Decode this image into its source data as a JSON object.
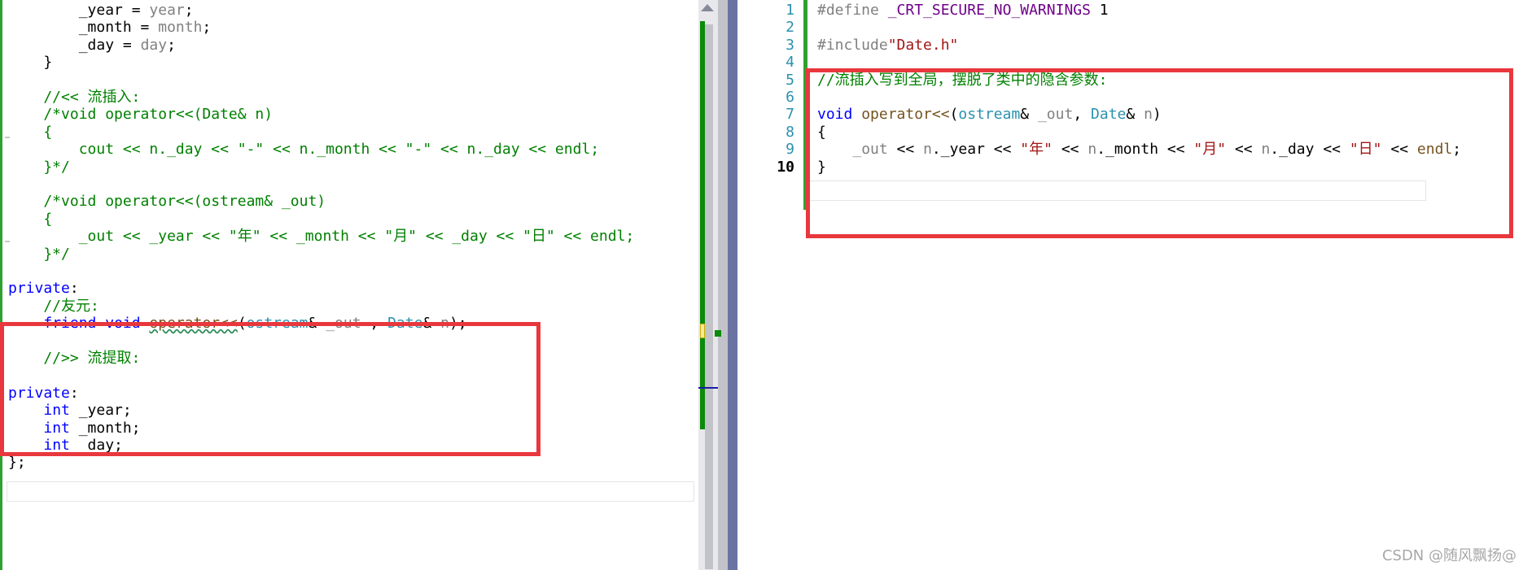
{
  "left_editor": {
    "lines": [
      {
        "segments": [
          {
            "t": "        _year = ",
            "c": ""
          },
          {
            "t": "year",
            "c": "var"
          },
          {
            "t": ";",
            "c": ""
          }
        ]
      },
      {
        "segments": [
          {
            "t": "        _month = ",
            "c": ""
          },
          {
            "t": "month",
            "c": "var"
          },
          {
            "t": ";",
            "c": ""
          }
        ]
      },
      {
        "segments": [
          {
            "t": "        _day = ",
            "c": ""
          },
          {
            "t": "day",
            "c": "var"
          },
          {
            "t": ";",
            "c": ""
          }
        ]
      },
      {
        "segments": [
          {
            "t": "    }",
            "c": ""
          }
        ]
      },
      {
        "segments": [
          {
            "t": "",
            "c": ""
          }
        ]
      },
      {
        "segments": [
          {
            "t": "    //<< 流插入:",
            "c": "cm"
          }
        ]
      },
      {
        "segments": [
          {
            "t": "    /*void operator<<(Date& n)",
            "c": "cm"
          }
        ]
      },
      {
        "segments": [
          {
            "t": "    {",
            "c": "cm"
          }
        ]
      },
      {
        "segments": [
          {
            "t": "        cout << n._day << \"-\" << n._month << \"-\" << n._day << endl;",
            "c": "cm"
          }
        ]
      },
      {
        "segments": [
          {
            "t": "    }*/",
            "c": "cm"
          }
        ]
      },
      {
        "segments": [
          {
            "t": "",
            "c": ""
          }
        ]
      },
      {
        "segments": [
          {
            "t": "    /*void operator<<(ostream& _out)",
            "c": "cm"
          }
        ]
      },
      {
        "segments": [
          {
            "t": "    {",
            "c": "cm"
          }
        ]
      },
      {
        "segments": [
          {
            "t": "        _out << _year << \"年\" << _month << \"月\" << _day << \"日\" << endl;",
            "c": "cm"
          }
        ]
      },
      {
        "segments": [
          {
            "t": "    }*/",
            "c": "cm"
          }
        ]
      },
      {
        "segments": [
          {
            "t": "",
            "c": ""
          }
        ]
      },
      {
        "segments": [
          {
            "t": "private",
            "c": "kw"
          },
          {
            "t": ":",
            "c": ""
          }
        ]
      },
      {
        "segments": [
          {
            "t": "    //友元:",
            "c": "cm"
          }
        ]
      },
      {
        "segments": [
          {
            "t": "    ",
            "c": ""
          },
          {
            "t": "friend",
            "c": "kw"
          },
          {
            "t": " ",
            "c": ""
          },
          {
            "t": "void",
            "c": "kw"
          },
          {
            "t": " ",
            "c": ""
          },
          {
            "t": "operator<<",
            "c": "fn squiggle"
          },
          {
            "t": "(",
            "c": ""
          },
          {
            "t": "ostream",
            "c": "ty"
          },
          {
            "t": "& ",
            "c": ""
          },
          {
            "t": "_out",
            "c": "var"
          },
          {
            "t": " , ",
            "c": ""
          },
          {
            "t": "Date",
            "c": "ty"
          },
          {
            "t": "& ",
            "c": ""
          },
          {
            "t": "n",
            "c": "var"
          },
          {
            "t": ");",
            "c": ""
          }
        ]
      },
      {
        "segments": [
          {
            "t": "",
            "c": ""
          }
        ]
      },
      {
        "segments": [
          {
            "t": "    //>> 流提取:",
            "c": "cm"
          }
        ]
      },
      {
        "segments": [
          {
            "t": "",
            "c": ""
          }
        ]
      },
      {
        "segments": [
          {
            "t": "private",
            "c": "kw"
          },
          {
            "t": ":",
            "c": ""
          }
        ]
      },
      {
        "segments": [
          {
            "t": "    ",
            "c": ""
          },
          {
            "t": "int",
            "c": "kw"
          },
          {
            "t": " _year;",
            "c": ""
          }
        ]
      },
      {
        "segments": [
          {
            "t": "    ",
            "c": ""
          },
          {
            "t": "int",
            "c": "kw"
          },
          {
            "t": " _month;",
            "c": ""
          }
        ]
      },
      {
        "segments": [
          {
            "t": "    ",
            "c": ""
          },
          {
            "t": "int",
            "c": "kw"
          },
          {
            "t": " _day;",
            "c": ""
          }
        ]
      },
      {
        "segments": [
          {
            "t": "};",
            "c": ""
          }
        ]
      }
    ]
  },
  "right_editor": {
    "line_numbers": [
      "1",
      "2",
      "3",
      "4",
      "5",
      "6",
      "7",
      "8",
      "9",
      "10"
    ],
    "current_line": "10",
    "lines": [
      {
        "segments": [
          {
            "t": "#define",
            "c": "pp"
          },
          {
            "t": " ",
            "c": ""
          },
          {
            "t": "_CRT_SECURE_NO_WARNINGS",
            "c": "mac"
          },
          {
            "t": " 1",
            "c": ""
          }
        ]
      },
      {
        "segments": [
          {
            "t": "",
            "c": ""
          }
        ]
      },
      {
        "segments": [
          {
            "t": "#include",
            "c": "pp"
          },
          {
            "t": "\"Date.h\"",
            "c": "str"
          }
        ]
      },
      {
        "segments": [
          {
            "t": "",
            "c": ""
          }
        ]
      },
      {
        "segments": [
          {
            "t": "//流插入写到全局，摆脱了类中的隐含参数:",
            "c": "cm"
          }
        ]
      },
      {
        "segments": [
          {
            "t": "",
            "c": ""
          }
        ]
      },
      {
        "segments": [
          {
            "t": "void",
            "c": "kw"
          },
          {
            "t": " ",
            "c": ""
          },
          {
            "t": "operator<<",
            "c": "fn"
          },
          {
            "t": "(",
            "c": ""
          },
          {
            "t": "ostream",
            "c": "ty"
          },
          {
            "t": "& ",
            "c": ""
          },
          {
            "t": "_out",
            "c": "var"
          },
          {
            "t": ", ",
            "c": ""
          },
          {
            "t": "Date",
            "c": "ty"
          },
          {
            "t": "& ",
            "c": ""
          },
          {
            "t": "n",
            "c": "var"
          },
          {
            "t": ")",
            "c": ""
          }
        ]
      },
      {
        "segments": [
          {
            "t": "{",
            "c": ""
          }
        ]
      },
      {
        "segments": [
          {
            "t": "    ",
            "c": ""
          },
          {
            "t": "_out",
            "c": "var"
          },
          {
            "t": " << ",
            "c": ""
          },
          {
            "t": "n",
            "c": "var"
          },
          {
            "t": "._year << ",
            "c": ""
          },
          {
            "t": "\"年\"",
            "c": "str"
          },
          {
            "t": " << ",
            "c": ""
          },
          {
            "t": "n",
            "c": "var"
          },
          {
            "t": "._month << ",
            "c": ""
          },
          {
            "t": "\"月\"",
            "c": "str"
          },
          {
            "t": " << ",
            "c": ""
          },
          {
            "t": "n",
            "c": "var"
          },
          {
            "t": "._day << ",
            "c": ""
          },
          {
            "t": "\"日\"",
            "c": "str"
          },
          {
            "t": " << ",
            "c": ""
          },
          {
            "t": "endl",
            "c": "fn"
          },
          {
            "t": ";",
            "c": ""
          }
        ]
      },
      {
        "segments": [
          {
            "t": "}",
            "c": ""
          }
        ]
      }
    ]
  },
  "watermark": "CSDN @随风飘扬@",
  "colors": {
    "highlight_box": "#e8383d",
    "keyword": "#0000ff",
    "type": "#2b91af",
    "comment": "#008000",
    "string": "#a31515",
    "macro": "#6f008a",
    "change_bar": "#2fa12f"
  }
}
